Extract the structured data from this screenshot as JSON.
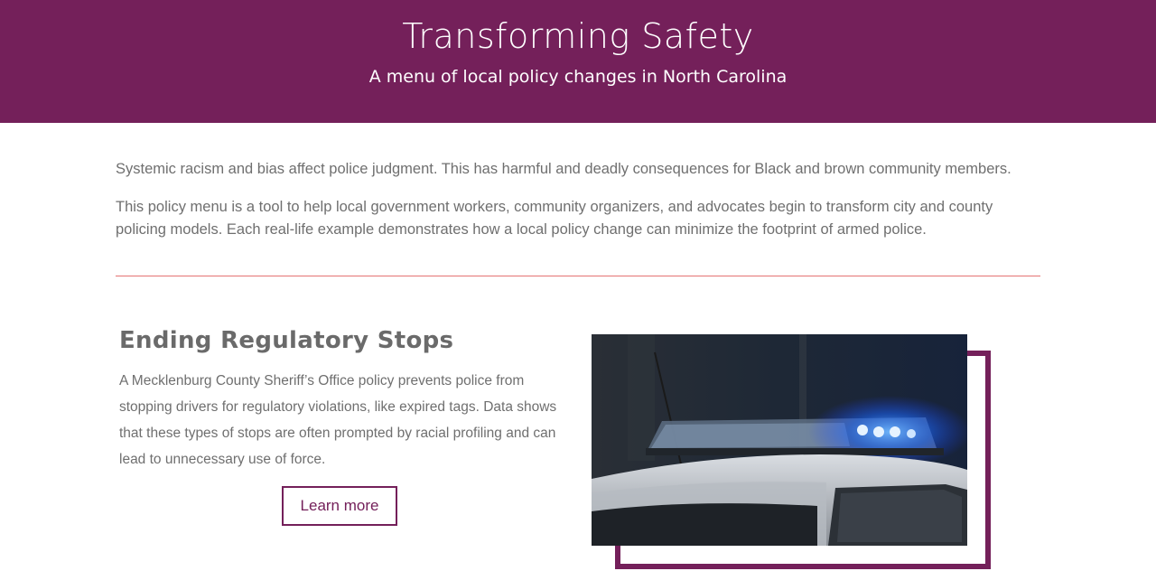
{
  "header": {
    "title": "Transforming Safety",
    "subtitle": "A menu of local policy changes in North Carolina"
  },
  "intro": {
    "paragraph_1": "Systemic racism and bias affect police judgment. This has harmful and deadly consequences for Black and brown community members.",
    "paragraph_2": "This policy menu is a tool to help local government workers, community organizers, and advocates begin to transform city and county policing models. Each real-life example demonstrates how a local policy change can minimize the footprint of armed police."
  },
  "feature": {
    "title": "Ending Regulatory Stops",
    "description": "A Mecklenburg County Sheriff’s Office policy prevents police from stopping drivers for regulatory violations, like expired tags. Data shows that these types of stops are often prompted by racial profiling and can lead to unnecessary use of force.",
    "button_label": "Learn more",
    "image_subject": "police-car-light-bar-photo"
  },
  "colors": {
    "brand_purple": "#74205a",
    "divider_red": "#e57373",
    "body_text": "#6f6f6f"
  }
}
